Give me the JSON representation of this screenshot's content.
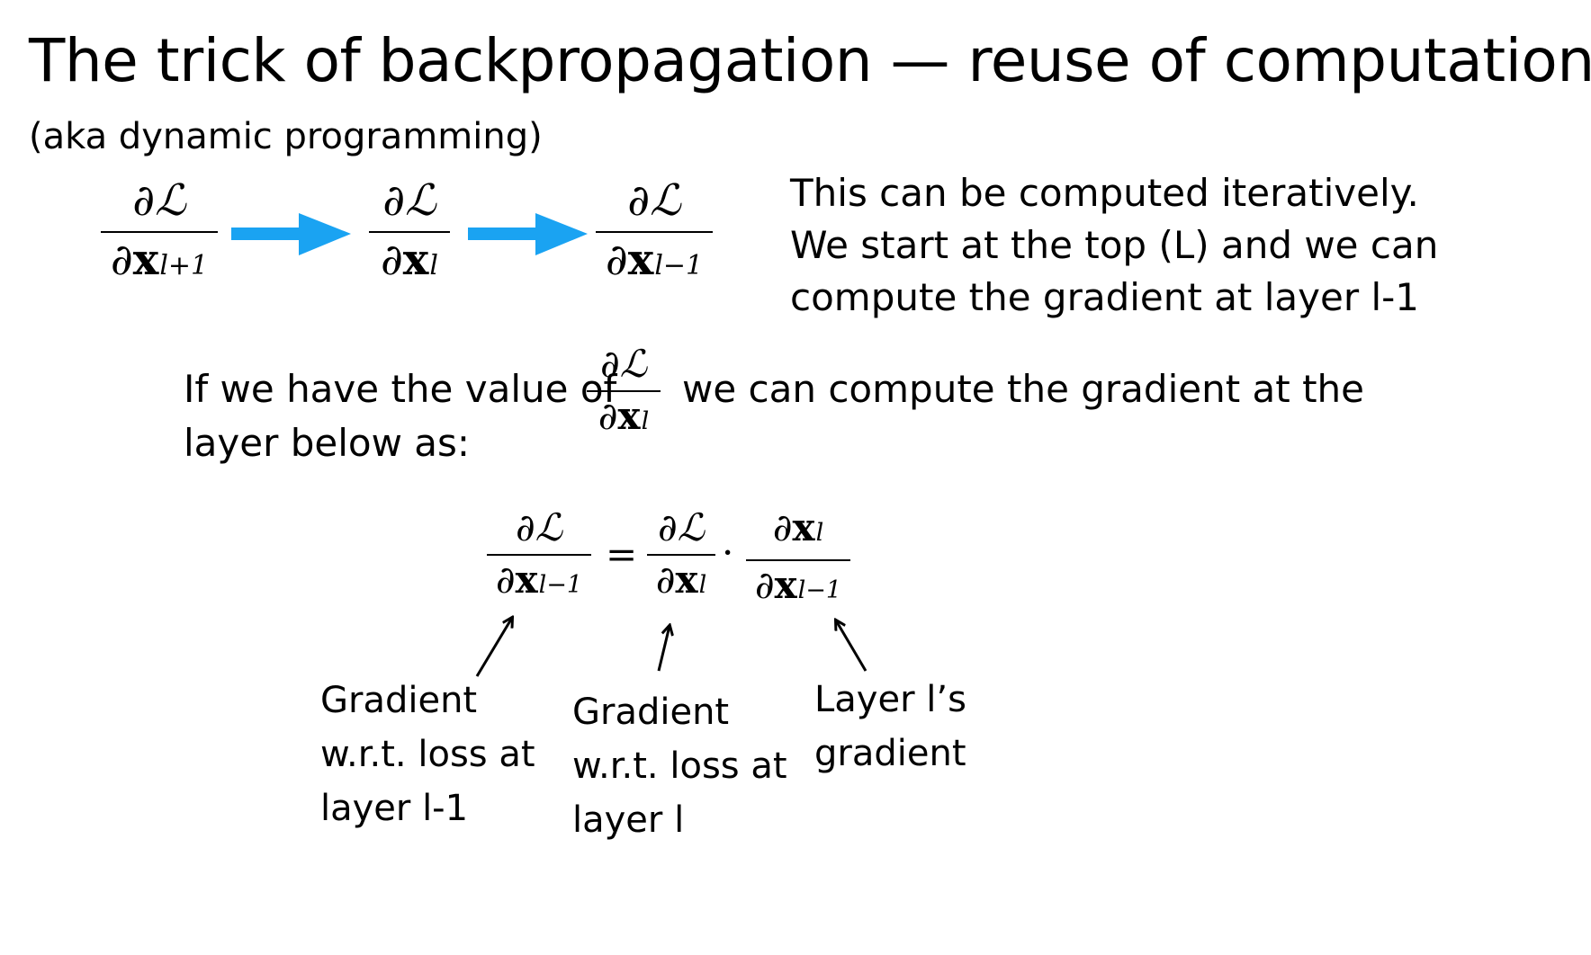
{
  "slide": {
    "title": "The trick of backpropagation — reuse of computation",
    "subtitle": "(aka dynamic programming)"
  },
  "notes": {
    "iterative": [
      "This can be computed iteratively.",
      "We start at the top (L) and we can",
      "compute the gradient at layer l-1"
    ],
    "if_prefix": "If we have the value of",
    "if_suffix": "we can compute the gradient at the",
    "if_line2": "layer below as:"
  },
  "math": {
    "partial": "∂",
    "loss": "ℒ",
    "vec": "x",
    "sub_next": "l+1",
    "sub_cur": "l",
    "sub_prev": "l−1",
    "equals": "=",
    "dot": "·"
  },
  "captions": {
    "left": [
      "Gradient",
      "w.r.t. loss at",
      "layer l-1"
    ],
    "middle": [
      "Gradient",
      "w.r.t. loss at",
      "layer l"
    ],
    "right": [
      "Layer l’s",
      "gradient"
    ]
  },
  "colors": {
    "arrow": "#1aa3f2",
    "text": "#000000"
  }
}
